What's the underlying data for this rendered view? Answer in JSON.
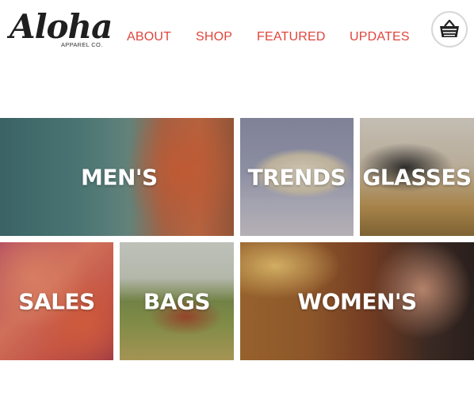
{
  "brand": {
    "name": "Aloha",
    "sub": "APPAREL CO."
  },
  "nav": [
    {
      "label": "ABOUT"
    },
    {
      "label": "SHOP"
    },
    {
      "label": "FEATURED"
    },
    {
      "label": "UPDATES"
    }
  ],
  "colors": {
    "accent": "#e0443b",
    "text": "#1f1f1f",
    "tile_label": "#ffffff"
  },
  "cart": {
    "icon": "basket-icon"
  },
  "tiles": [
    {
      "label": "MEN'S"
    },
    {
      "label": "TRENDS"
    },
    {
      "label": "GLASSES"
    },
    {
      "label": "SALES"
    },
    {
      "label": "BAGS"
    },
    {
      "label": "WOMEN'S"
    }
  ]
}
